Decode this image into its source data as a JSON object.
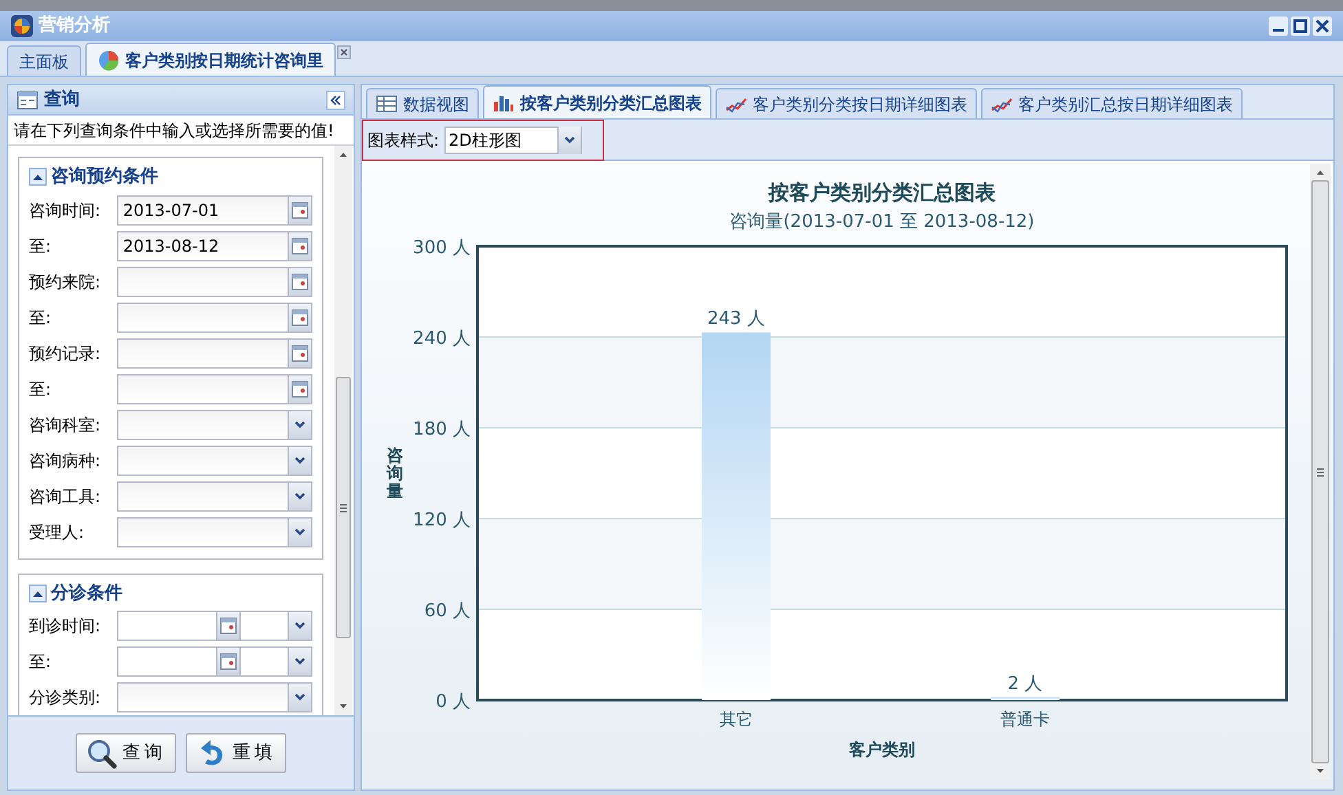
{
  "window": {
    "title": "营销分析"
  },
  "tabs": [
    {
      "label": "主面板",
      "selected": false,
      "closable": false
    },
    {
      "label": "客户类别按日期统计咨询里",
      "selected": true,
      "closable": true
    }
  ],
  "query_panel": {
    "title": "查询",
    "hint": "请在下列查询条件中输入或选择所需要的值!",
    "sections": [
      {
        "title": "咨询预约条件",
        "expanded": true,
        "fields": [
          {
            "label": "咨询时间:",
            "kind": "date",
            "value": "2013-07-01"
          },
          {
            "label": "至:",
            "kind": "date",
            "value": "2013-08-12"
          },
          {
            "label": "预约来院:",
            "kind": "date"
          },
          {
            "label": "至:",
            "kind": "date"
          },
          {
            "label": "预约记录:",
            "kind": "date"
          },
          {
            "label": "至:",
            "kind": "date"
          },
          {
            "label": "咨询科室:",
            "kind": "select"
          },
          {
            "label": "咨询病种:",
            "kind": "select"
          },
          {
            "label": "咨询工具:",
            "kind": "select"
          },
          {
            "label": "受理人:",
            "kind": "select"
          }
        ]
      },
      {
        "title": "分诊条件",
        "expanded": true,
        "fields": [
          {
            "label": "到诊时间:",
            "kind": "datetime"
          },
          {
            "label": "至:",
            "kind": "datetime"
          },
          {
            "label": "分诊类别:",
            "kind": "select"
          }
        ]
      }
    ],
    "buttons": [
      {
        "label": "查询",
        "kind": "search"
      },
      {
        "label": "重填",
        "kind": "reset"
      }
    ]
  },
  "chart_tabs": [
    {
      "label": "数据视图",
      "kind": "grid",
      "selected": false
    },
    {
      "label": "按客户类别分类汇总图表",
      "kind": "bar",
      "selected": true
    },
    {
      "label": "客户类别分类按日期详细图表",
      "kind": "line",
      "selected": false
    },
    {
      "label": "客户类别汇总按日期详细图表",
      "kind": "line",
      "selected": false
    }
  ],
  "toolbar": {
    "label": "图表样式:",
    "chart_style": "2D柱形图"
  },
  "chart": {
    "subtitle": "咨询量(2013-07-01 至 2013-08-12)",
    "chart_data": {
      "type": "bar",
      "title": "按客户类别分类汇总图表",
      "xlabel": "客户类别",
      "ylabel": "咨询量",
      "categories": [
        "其它",
        "普通卡"
      ],
      "values": [
        243,
        2
      ],
      "grid": true,
      "ylim": [
        0,
        300
      ],
      "yticks": [
        {
          "value": 0,
          "label": "0 人"
        },
        {
          "value": 60,
          "label": "60 人"
        },
        {
          "value": 120,
          "label": "120 人"
        },
        {
          "value": 180,
          "label": "180 人"
        },
        {
          "value": 240,
          "label": "240 人"
        },
        {
          "value": 300,
          "label": "300 人"
        }
      ],
      "value_labels": [
        "243 人",
        "2 人"
      ]
    }
  }
}
